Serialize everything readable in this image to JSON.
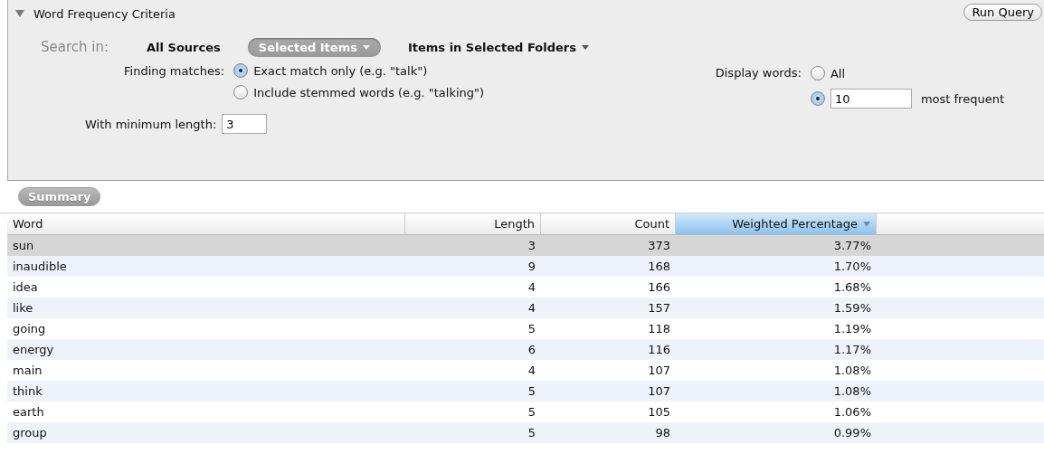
{
  "criteria": {
    "title": "Word Frequency Criteria",
    "expanded": true,
    "run_button": "Run Query",
    "search_in": {
      "label": "Search in:",
      "options": [
        {
          "label": "All Sources",
          "selected": false,
          "menu": false
        },
        {
          "label": "Selected Items",
          "selected": true,
          "menu": true
        },
        {
          "label": "Items in Selected Folders",
          "selected": false,
          "menu": true
        }
      ]
    },
    "finding_matches": {
      "label": "Finding matches:",
      "options": [
        {
          "label": "Exact match only (e.g. \"talk\")",
          "selected": true
        },
        {
          "label": "Include stemmed words (e.g. \"talking\")",
          "selected": false
        }
      ]
    },
    "display_words": {
      "label": "Display words:",
      "options": [
        {
          "kind": "plain",
          "label": "All",
          "selected": false
        },
        {
          "kind": "count",
          "value": "10",
          "suffix": "most frequent",
          "selected": true
        }
      ]
    },
    "min_length": {
      "label": "With minimum length:",
      "value": "3"
    }
  },
  "results_tabs": [
    {
      "label": "Summary",
      "selected": true
    }
  ],
  "table": {
    "columns": [
      {
        "label": "Word",
        "sorted": false
      },
      {
        "label": "Length",
        "sorted": false
      },
      {
        "label": "Count",
        "sorted": false
      },
      {
        "label": "Weighted Percentage",
        "sorted": true
      }
    ],
    "rows": [
      {
        "cells": [
          "sun",
          "3",
          "373",
          "3.77%"
        ],
        "selected": true
      },
      {
        "cells": [
          "inaudible",
          "9",
          "168",
          "1.70%"
        ],
        "selected": false
      },
      {
        "cells": [
          "idea",
          "4",
          "166",
          "1.68%"
        ],
        "selected": false
      },
      {
        "cells": [
          "like",
          "4",
          "157",
          "1.59%"
        ],
        "selected": false
      },
      {
        "cells": [
          "going",
          "5",
          "118",
          "1.19%"
        ],
        "selected": false
      },
      {
        "cells": [
          "energy",
          "6",
          "116",
          "1.17%"
        ],
        "selected": false
      },
      {
        "cells": [
          "main",
          "4",
          "107",
          "1.08%"
        ],
        "selected": false
      },
      {
        "cells": [
          "think",
          "5",
          "107",
          "1.08%"
        ],
        "selected": false
      },
      {
        "cells": [
          "earth",
          "5",
          "105",
          "1.06%"
        ],
        "selected": false
      },
      {
        "cells": [
          "group",
          "5",
          "98",
          "0.99%"
        ],
        "selected": false
      }
    ]
  }
}
